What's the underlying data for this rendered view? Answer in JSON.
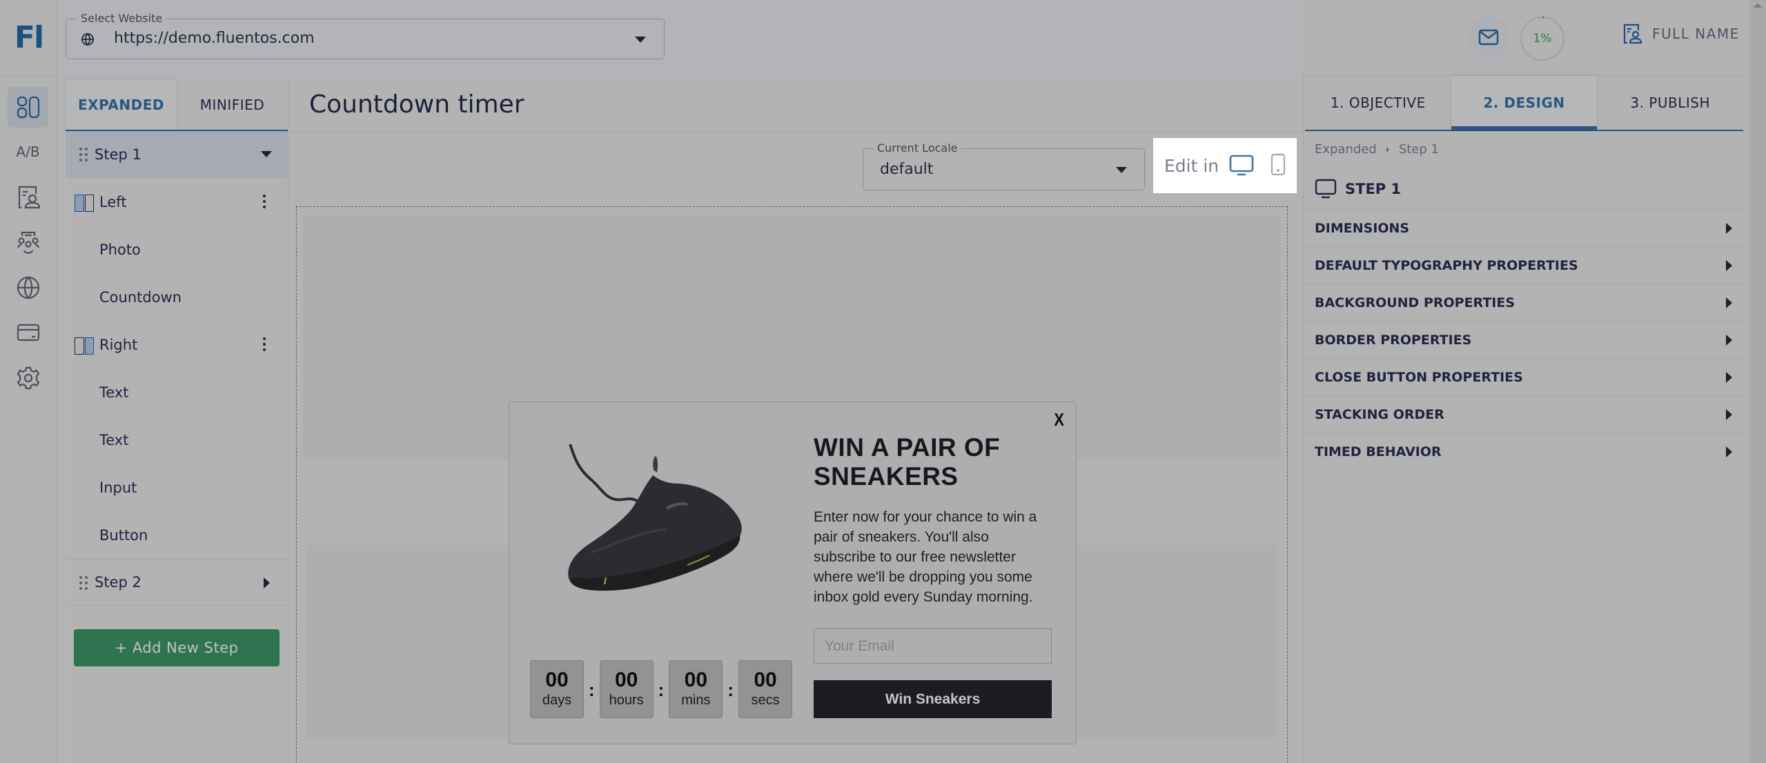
{
  "app": {
    "logo_text": "Fl",
    "brand_color": "#1f5180",
    "accent_green": "#2f7350"
  },
  "rail": {
    "items": [
      {
        "name": "layouts",
        "icon": "layout-grid-icon",
        "active": true
      },
      {
        "name": "ab-testing",
        "label": "A/B"
      },
      {
        "name": "contacts",
        "icon": "contact-card-icon"
      },
      {
        "name": "audience",
        "icon": "audience-group-icon"
      },
      {
        "name": "websites",
        "icon": "globe-icon"
      },
      {
        "name": "billing",
        "icon": "credit-card-icon"
      },
      {
        "name": "settings",
        "icon": "gear-icon"
      }
    ]
  },
  "header": {
    "site_select": {
      "label": "Select Website",
      "value": "https://demo.fluentos.com",
      "icon": "globe-icon"
    },
    "mail_icon": "mail-icon",
    "progress": {
      "value_percent": 1,
      "label": "1%"
    },
    "user": {
      "label": "FULL NAME",
      "icon": "contact-card-icon"
    }
  },
  "layers": {
    "tabs": [
      {
        "label": "EXPANDED",
        "active": true
      },
      {
        "label": "MINIFIED",
        "active": false
      }
    ],
    "steps": [
      {
        "label": "Step 1",
        "expanded": true,
        "children": [
          {
            "label": "Left",
            "type": "column",
            "side": "left",
            "menu": true
          },
          {
            "label": "Photo",
            "type": "element"
          },
          {
            "label": "Countdown",
            "type": "element"
          },
          {
            "label": "Right",
            "type": "column",
            "side": "right",
            "menu": true
          },
          {
            "label": "Text",
            "type": "element"
          },
          {
            "label": "Text",
            "type": "element"
          },
          {
            "label": "Input",
            "type": "element"
          },
          {
            "label": "Button",
            "type": "element"
          }
        ]
      },
      {
        "label": "Step 2",
        "expanded": false
      }
    ],
    "add_step_label": "+ Add New Step"
  },
  "canvas": {
    "title": "Countdown timer",
    "locale": {
      "label": "Current Locale",
      "value": "default"
    },
    "edit_in": {
      "label": "Edit in",
      "devices": [
        "desktop",
        "mobile"
      ],
      "active_device": "desktop"
    },
    "popup": {
      "close_label": "X",
      "image_alt": "sneaker-photo",
      "headline": "WIN A PAIR OF SNEAKERS",
      "body": "Enter now for your chance to win a pair of sneakers. You'll also subscribe to our free newsletter where we'll be dropping you some inbox gold every Sunday morning.",
      "email_placeholder": "Your Email",
      "email_value": "",
      "button_label": "Win Sneakers",
      "countdown": [
        {
          "value": "00",
          "unit": "days"
        },
        {
          "value": "00",
          "unit": "hours"
        },
        {
          "value": "00",
          "unit": "mins"
        },
        {
          "value": "00",
          "unit": "secs"
        }
      ],
      "countdown_separator": ":"
    }
  },
  "properties": {
    "tabs": [
      {
        "label": "1. OBJECTIVE",
        "active": false
      },
      {
        "label": "2. DESIGN",
        "active": true
      },
      {
        "label": "3. PUBLISH",
        "active": false
      }
    ],
    "breadcrumb": [
      "Expanded",
      "Step 1"
    ],
    "section_title": "STEP 1",
    "sections": [
      "DIMENSIONS",
      "DEFAULT TYPOGRAPHY PROPERTIES",
      "BACKGROUND PROPERTIES",
      "BORDER PROPERTIES",
      "CLOSE BUTTON PROPERTIES",
      "STACKING ORDER",
      "TIMED BEHAVIOR"
    ]
  }
}
